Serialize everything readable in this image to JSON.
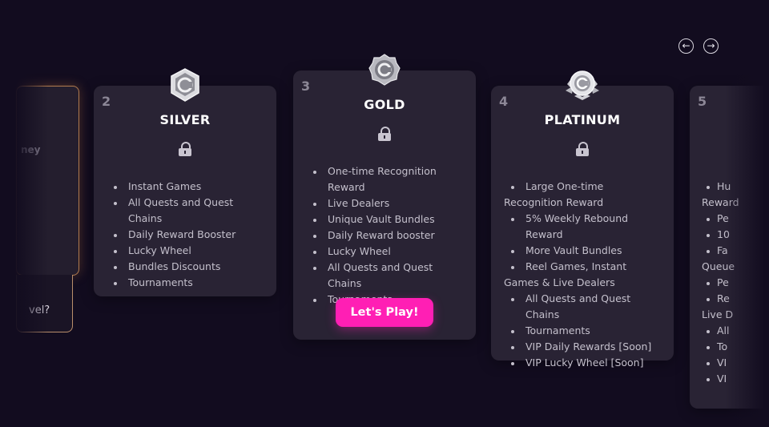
{
  "nav": {
    "prev_label": "←",
    "next_label": "→"
  },
  "prev_card": {
    "text_fragment": "ney",
    "question_fragment": "vel?"
  },
  "cards": [
    {
      "number": "2",
      "title": "SILVER",
      "perks": [
        "Instant Games",
        "All Quests and Quest Chains",
        "Daily Reward Booster",
        "Lucky Wheel",
        "Bundles Discounts",
        "Tournaments"
      ]
    },
    {
      "number": "3",
      "title": "GOLD",
      "perks": [
        "One-time Recognition Reward",
        "Live Dealers",
        "Unique Vault Bundles",
        "Daily Reward booster",
        "Lucky Wheel",
        "All Quests and Quest Chains",
        "Tournaments"
      ],
      "cta_label": "Let's Play!"
    },
    {
      "number": "4",
      "title": "PLATINUM",
      "perks": [
        "Large One-time Recognition Reward",
        "5% Weekly Rebound Reward",
        "More Vault Bundles",
        "Reel Games, Instant Games & Live Dealers",
        "All Quests and Quest Chains",
        "Tournaments",
        "VIP Daily Rewards [Soon]",
        "VIP Lucky Wheel [Soon]"
      ]
    },
    {
      "number": "5",
      "perk_fragments": [
        "Hu",
        "Reward",
        "Pe",
        "10",
        "Fa",
        "Queue",
        "Pe",
        "Re",
        "Live D",
        "All",
        "To",
        "VI",
        "VI"
      ]
    }
  ],
  "colors": {
    "background": "#120c1f",
    "card": "#292334",
    "cta": "#ff1fb4",
    "prev_border": "#b07a4e"
  },
  "icons": {
    "badge_silver": "silver-badge-icon",
    "badge_gold": "gold-badge-icon",
    "badge_platinum": "platinum-badge-icon",
    "lock": "lock-icon"
  }
}
